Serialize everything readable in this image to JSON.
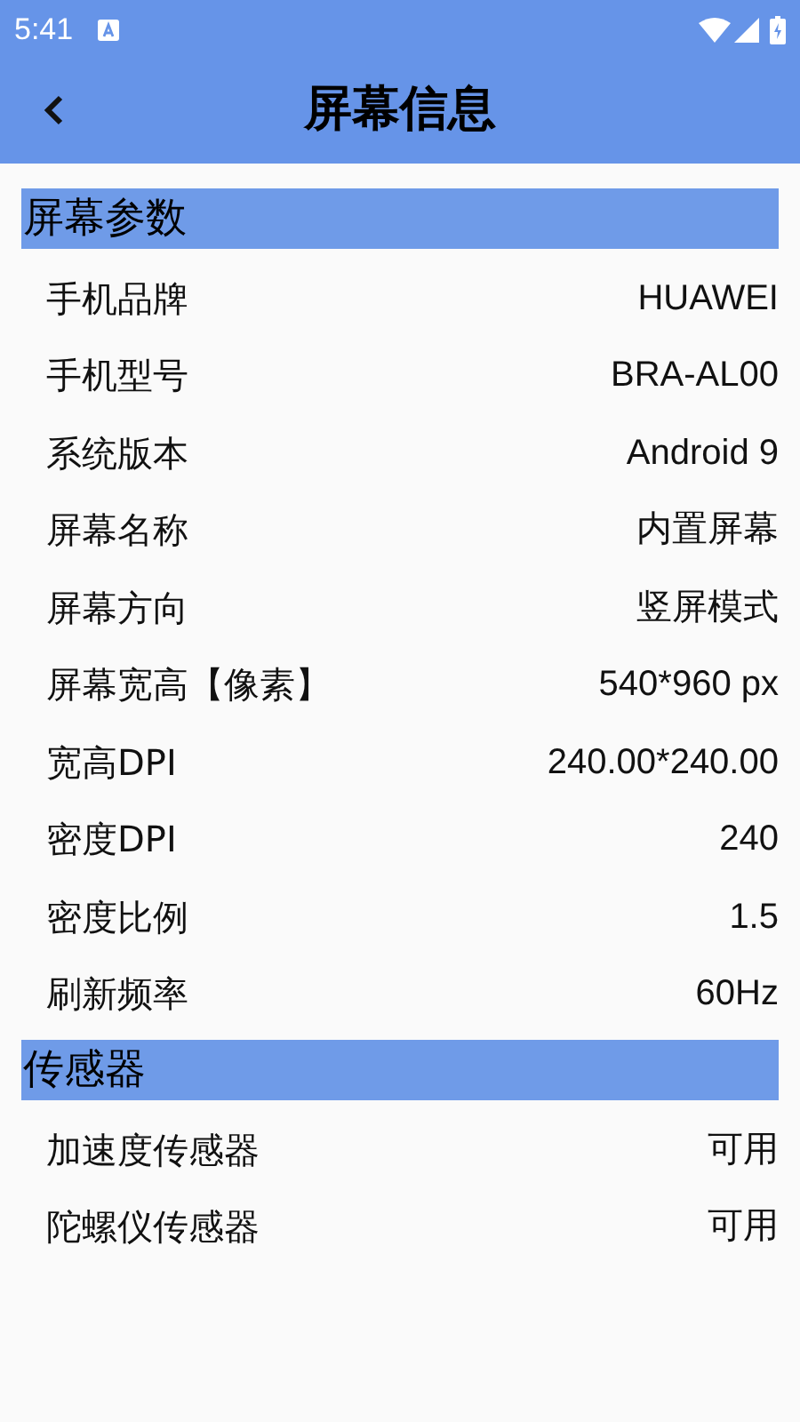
{
  "status_bar": {
    "time": "5:41"
  },
  "header": {
    "title": "屏幕信息"
  },
  "sections": [
    {
      "title": "屏幕参数",
      "rows": [
        {
          "label": "手机品牌",
          "value": "HUAWEI"
        },
        {
          "label": "手机型号",
          "value": "BRA-AL00"
        },
        {
          "label": "系统版本",
          "value": "Android 9"
        },
        {
          "label": "屏幕名称",
          "value": "内置屏幕"
        },
        {
          "label": "屏幕方向",
          "value": "竖屏模式"
        },
        {
          "label": "屏幕宽高【像素】",
          "value": "540*960 px"
        },
        {
          "label": "宽高DPI",
          "value": "240.00*240.00"
        },
        {
          "label": "密度DPI",
          "value": "240"
        },
        {
          "label": "密度比例",
          "value": "1.5"
        },
        {
          "label": "刷新频率",
          "value": "60Hz"
        }
      ]
    },
    {
      "title": "传感器",
      "rows": [
        {
          "label": "加速度传感器",
          "value": "可用"
        },
        {
          "label": "陀螺仪传感器",
          "value": "可用"
        }
      ]
    }
  ]
}
